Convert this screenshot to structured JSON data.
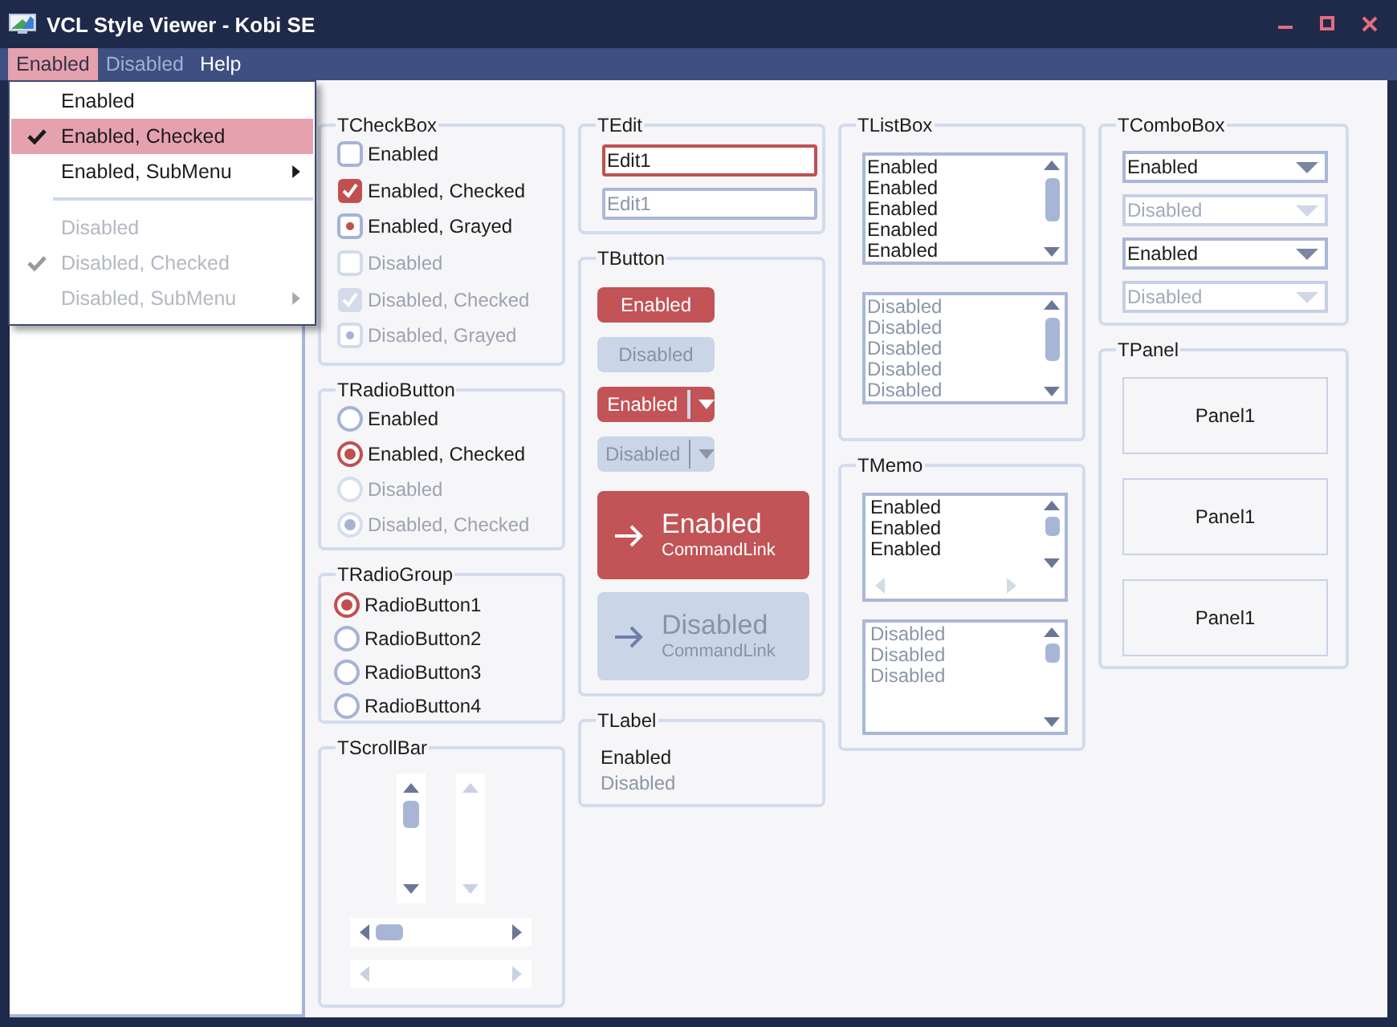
{
  "window": {
    "title": "VCL Style Viewer - Kobi SE"
  },
  "menu_bar": [
    {
      "label": "Enabled",
      "selected": true,
      "disabled": false
    },
    {
      "label": "Disabled",
      "selected": false,
      "disabled": true
    },
    {
      "label": "Help",
      "selected": false,
      "disabled": false
    }
  ],
  "dropdown_menu": {
    "items": [
      {
        "kind": "item",
        "label": "Enabled",
        "checked": false,
        "disabled": false,
        "submenu": false,
        "selected": false
      },
      {
        "kind": "item",
        "label": "Enabled, Checked",
        "checked": true,
        "disabled": false,
        "submenu": false,
        "selected": true
      },
      {
        "kind": "item",
        "label": "Enabled, SubMenu",
        "checked": false,
        "disabled": false,
        "submenu": true,
        "selected": false
      },
      {
        "kind": "separator"
      },
      {
        "kind": "item",
        "label": "Disabled",
        "checked": false,
        "disabled": true,
        "submenu": false,
        "selected": false
      },
      {
        "kind": "item",
        "label": "Disabled, Checked",
        "checked": true,
        "disabled": true,
        "submenu": false,
        "selected": false
      },
      {
        "kind": "item",
        "label": "Disabled, SubMenu",
        "checked": false,
        "disabled": true,
        "submenu": true,
        "selected": false
      }
    ]
  },
  "columns": [
    {
      "groups": [
        {
          "kind": "checkbox",
          "title": "TCheckBox",
          "items": [
            {
              "label": "Enabled",
              "checked": false,
              "grayed": false,
              "disabled": false
            },
            {
              "label": "Enabled, Checked",
              "checked": true,
              "grayed": false,
              "disabled": false
            },
            {
              "label": "Enabled, Grayed",
              "checked": false,
              "grayed": true,
              "disabled": false
            },
            {
              "label": "Disabled",
              "checked": false,
              "grayed": false,
              "disabled": true
            },
            {
              "label": "Disabled, Checked",
              "checked": true,
              "grayed": false,
              "disabled": true
            },
            {
              "label": "Disabled, Grayed",
              "checked": false,
              "grayed": true,
              "disabled": true
            }
          ]
        },
        {
          "kind": "radio",
          "title": "TRadioButton",
          "items": [
            {
              "label": "Enabled",
              "checked": false,
              "disabled": false
            },
            {
              "label": "Enabled, Checked",
              "checked": true,
              "disabled": false
            },
            {
              "label": "Disabled",
              "checked": false,
              "disabled": true
            },
            {
              "label": "Disabled, Checked",
              "checked": true,
              "disabled": true
            }
          ]
        },
        {
          "kind": "radiogroup",
          "title": "TRadioGroup",
          "items": [
            {
              "label": "RadioButton1",
              "selected": true
            },
            {
              "label": "RadioButton2",
              "selected": false
            },
            {
              "label": "RadioButton3",
              "selected": false
            },
            {
              "label": "RadioButton4",
              "selected": false
            }
          ]
        },
        {
          "kind": "scrollbar",
          "title": "TScrollBar",
          "vertical_bars": [
            {
              "disabled": false
            },
            {
              "disabled": true
            }
          ],
          "horizontal_bars": [
            {
              "disabled": false
            },
            {
              "disabled": true
            }
          ]
        }
      ]
    },
    {
      "groups": [
        {
          "kind": "edit",
          "title": "TEdit",
          "fields": [
            {
              "value": "Edit1",
              "focused": true,
              "disabled": false
            },
            {
              "value": "Edit1",
              "focused": false,
              "disabled": true
            }
          ]
        },
        {
          "kind": "button",
          "title": "TButton",
          "buttons": [
            {
              "kind": "push",
              "label": "Enabled",
              "disabled": false
            },
            {
              "kind": "push",
              "label": "Disabled",
              "disabled": true
            },
            {
              "kind": "split",
              "label": "Enabled",
              "disabled": false
            },
            {
              "kind": "split",
              "label": "Disabled",
              "disabled": true
            },
            {
              "kind": "commandlink",
              "label": "Enabled",
              "note": "CommandLink",
              "disabled": false
            },
            {
              "kind": "commandlink",
              "label": "Disabled",
              "note": "CommandLink",
              "disabled": true
            }
          ]
        },
        {
          "kind": "label",
          "title": "TLabel",
          "labels": [
            {
              "text": "Enabled",
              "disabled": false
            },
            {
              "text": "Disabled",
              "disabled": true
            }
          ]
        }
      ]
    },
    {
      "groups": [
        {
          "kind": "listbox",
          "title": "TListBox",
          "lists": [
            {
              "disabled": false,
              "items": [
                "Enabled",
                "Enabled",
                "Enabled",
                "Enabled",
                "Enabled"
              ]
            },
            {
              "disabled": true,
              "items": [
                "Disabled",
                "Disabled",
                "Disabled",
                "Disabled",
                "Disabled"
              ]
            }
          ]
        },
        {
          "kind": "memo",
          "title": "TMemo",
          "memos": [
            {
              "disabled": false,
              "horizontal_scrollbar": true,
              "lines": [
                "Enabled",
                "Enabled",
                "Enabled"
              ]
            },
            {
              "disabled": true,
              "horizontal_scrollbar": false,
              "lines": [
                "Disabled",
                "Disabled",
                "Disabled"
              ]
            }
          ]
        }
      ]
    },
    {
      "groups": [
        {
          "kind": "combobox",
          "title": "TComboBox",
          "combos": [
            {
              "value": "Enabled",
              "disabled": false
            },
            {
              "value": "Disabled",
              "disabled": true
            },
            {
              "value": "Enabled",
              "disabled": false
            },
            {
              "value": "Disabled",
              "disabled": true
            }
          ]
        },
        {
          "kind": "panel",
          "title": "TPanel",
          "panels": [
            {
              "caption": "Panel1"
            },
            {
              "caption": "Panel1"
            },
            {
              "caption": "Panel1"
            }
          ]
        }
      ]
    }
  ]
}
